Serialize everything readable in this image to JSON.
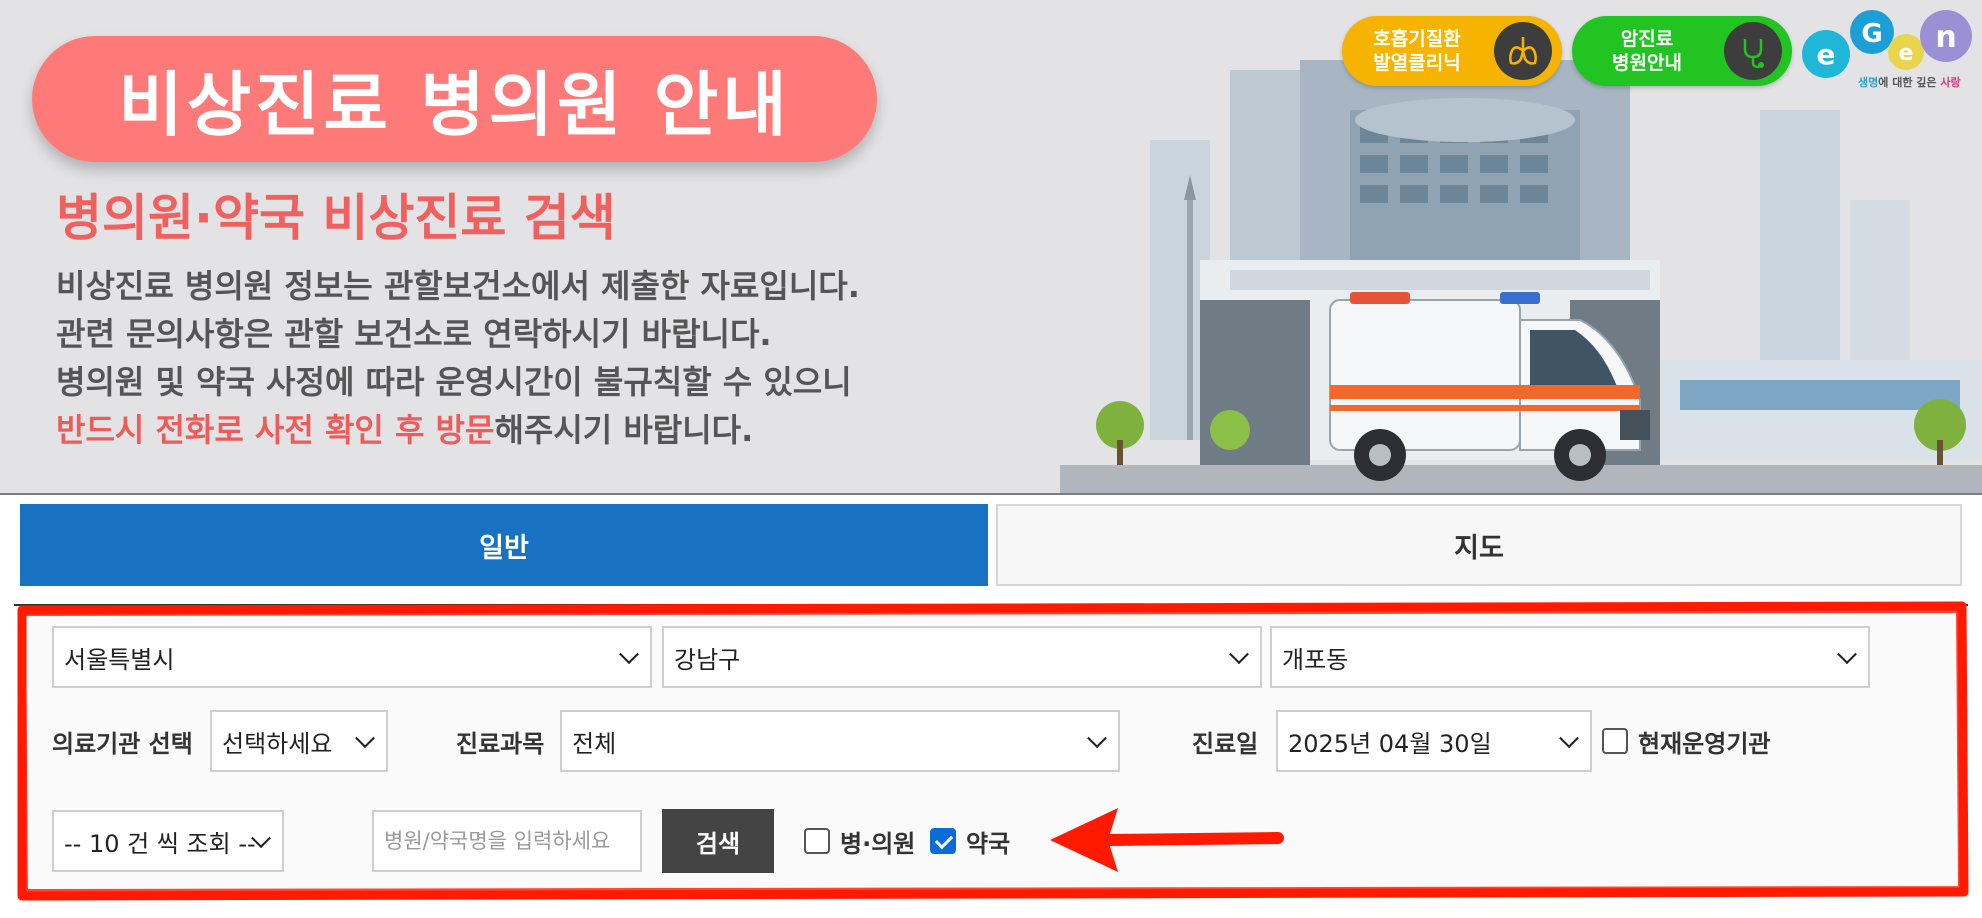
{
  "hero": {
    "title": "비상진료 병의원 안내",
    "subtitle": "병의원·약국 비상진료 검색",
    "lines": [
      "비상진료 병의원 정보는 관할보건소에서 제출한 자료입니다.",
      "관련 문의사항은 관할 보건소로 연락하시기 바랍니다.",
      "병의원 및 약국 사정에 따라 운영시간이 불규칙할 수 있으니"
    ],
    "warning_highlight": "반드시 전화로 사전 확인 후 방문",
    "warning_rest": "해주시기 바랍니다."
  },
  "badges": {
    "respiratory": "호흡기질환\n발열클리닉",
    "cancer": "암진료\n병원안내"
  },
  "logo": {
    "tagline_a": "생명",
    "tagline_b": "에 대한 깊은 ",
    "tagline_c": "사랑"
  },
  "tabs": {
    "general": "일반",
    "map": "지도"
  },
  "search": {
    "region": {
      "sido": "서울특별시",
      "sigungu": "강남구",
      "dong": "개포동"
    },
    "facility_label": "의료기관 선택",
    "facility_value": "선택하세요",
    "dept_label": "진료과목",
    "dept_value": "전체",
    "date_label": "진료일",
    "date_value": "2025년 04월 30일",
    "open_now_label": "현재운영기관",
    "open_now_checked": false,
    "page_size": "-- 10 건 씩 조회 --",
    "name_placeholder": "병원/약국명을 입력하세요",
    "search_button": "검색",
    "hospital_label": "병·의원",
    "hospital_checked": false,
    "pharmacy_label": "약국",
    "pharmacy_checked": true
  },
  "colors": {
    "title_pill": "#fd7a78",
    "accent_text": "#f0605e",
    "tab_active": "#1872c1",
    "annotation": "#ff1a00"
  }
}
